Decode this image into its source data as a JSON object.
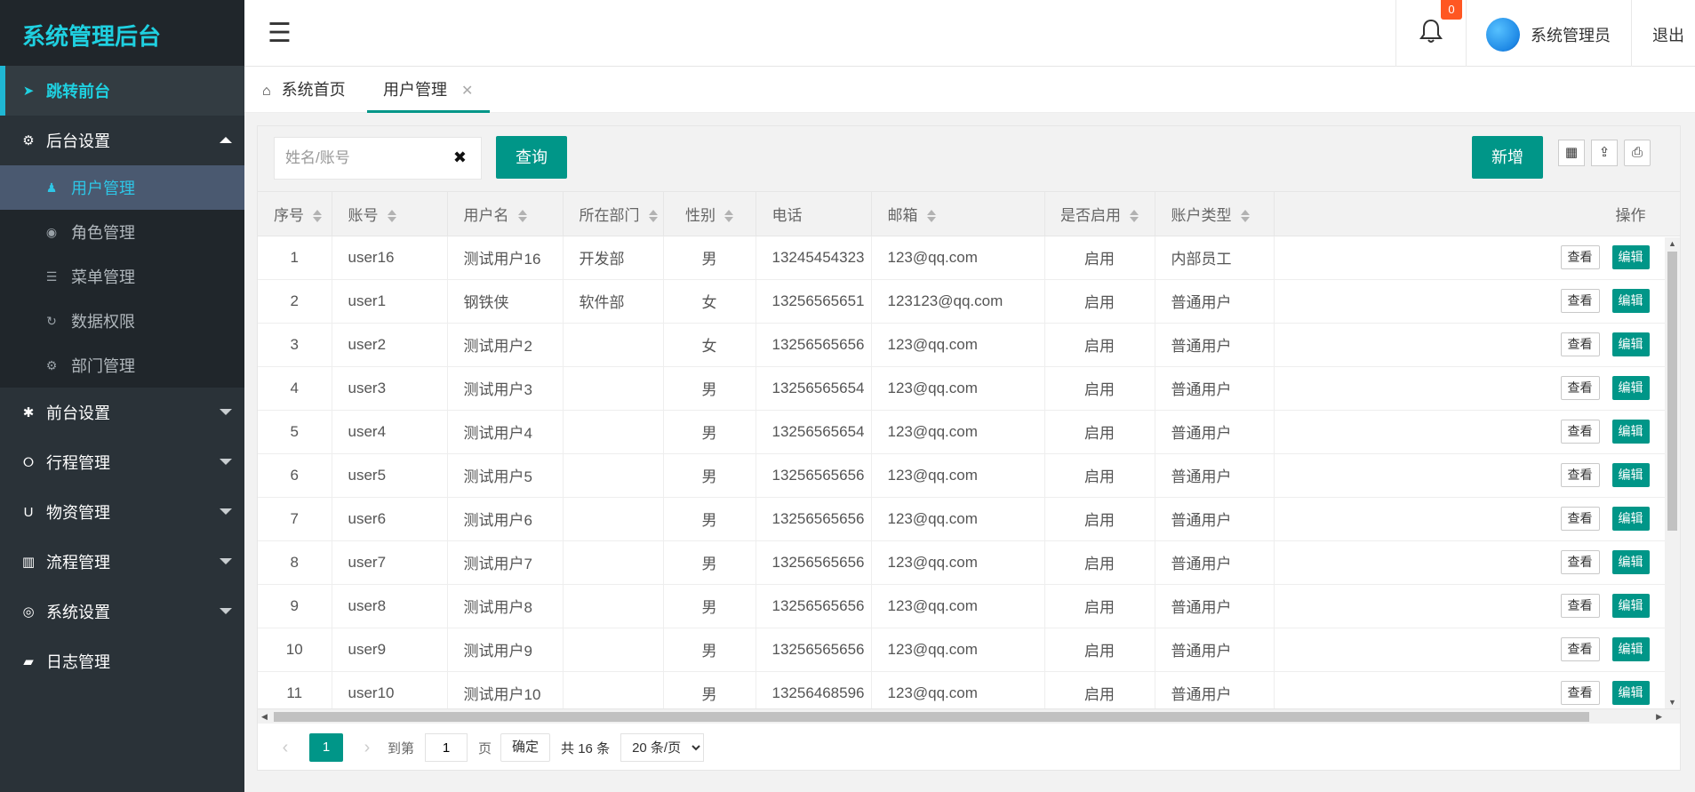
{
  "app": {
    "title": "系统管理后台"
  },
  "sidebar": {
    "front_link": "跳转前台",
    "groups": [
      {
        "label": "后台设置",
        "icon": "gear-icon",
        "open": true
      },
      {
        "label": "前台设置",
        "icon": "gear-icon"
      },
      {
        "label": "行程管理",
        "icon": "circle-icon"
      },
      {
        "label": "物资管理",
        "icon": "magnet-icon"
      },
      {
        "label": "流程管理",
        "icon": "barcode-icon"
      },
      {
        "label": "系统设置",
        "icon": "target-icon"
      },
      {
        "label": "日志管理",
        "icon": "book-icon"
      }
    ],
    "sub_items": [
      {
        "label": "用户管理",
        "icon": "user-icon",
        "active": true
      },
      {
        "label": "角色管理",
        "icon": "radio-icon"
      },
      {
        "label": "菜单管理",
        "icon": "list-icon"
      },
      {
        "label": "数据权限",
        "icon": "refresh-icon"
      },
      {
        "label": "部门管理",
        "icon": "gears-icon"
      }
    ]
  },
  "header": {
    "notification_count": "0",
    "user_name": "系统管理员",
    "logout_label": "退出"
  },
  "tabs": [
    {
      "label": "系统首页",
      "icon": "home-icon"
    },
    {
      "label": "用户管理",
      "active": true
    }
  ],
  "toolbar": {
    "search_placeholder": "姓名/账号",
    "search_value": "",
    "query_label": "查询",
    "add_label": "新增"
  },
  "table": {
    "columns": [
      "序号",
      "账号",
      "用户名",
      "所在部门",
      "性别",
      "电话",
      "邮箱",
      "是否启用",
      "账户类型",
      "操作"
    ],
    "view_label": "查看",
    "edit_label": "编辑",
    "rows": [
      [
        "1",
        "user16",
        "测试用户16",
        "开发部",
        "男",
        "13245454323",
        "123@qq.com",
        "启用",
        "内部员工"
      ],
      [
        "2",
        "user1",
        "钢铁侠",
        "软件部",
        "女",
        "13256565651",
        "123123@qq.com",
        "启用",
        "普通用户"
      ],
      [
        "3",
        "user2",
        "测试用户2",
        "",
        "女",
        "13256565656",
        "123@qq.com",
        "启用",
        "普通用户"
      ],
      [
        "4",
        "user3",
        "测试用户3",
        "",
        "男",
        "13256565654",
        "123@qq.com",
        "启用",
        "普通用户"
      ],
      [
        "5",
        "user4",
        "测试用户4",
        "",
        "男",
        "13256565654",
        "123@qq.com",
        "启用",
        "普通用户"
      ],
      [
        "6",
        "user5",
        "测试用户5",
        "",
        "男",
        "13256565656",
        "123@qq.com",
        "启用",
        "普通用户"
      ],
      [
        "7",
        "user6",
        "测试用户6",
        "",
        "男",
        "13256565656",
        "123@qq.com",
        "启用",
        "普通用户"
      ],
      [
        "8",
        "user7",
        "测试用户7",
        "",
        "男",
        "13256565656",
        "123@qq.com",
        "启用",
        "普通用户"
      ],
      [
        "9",
        "user8",
        "测试用户8",
        "",
        "男",
        "13256565656",
        "123@qq.com",
        "启用",
        "普通用户"
      ],
      [
        "10",
        "user9",
        "测试用户9",
        "",
        "男",
        "13256565656",
        "123@qq.com",
        "启用",
        "普通用户"
      ],
      [
        "11",
        "user10",
        "测试用户10",
        "",
        "男",
        "13256468596",
        "123@qq.com",
        "启用",
        "普通用户"
      ]
    ]
  },
  "pager": {
    "current_page": "1",
    "goto_label": "到第",
    "goto_value": "1",
    "page_unit": "页",
    "confirm_label": "确定",
    "total_text": "共 16 条",
    "page_size": "20 条/页"
  },
  "colors": {
    "accent": "#009688",
    "sidebar_bg": "#2a3238",
    "logo_text": "#1fd0e0",
    "active_sub_bg": "#4a5970",
    "badge": "#ff5722"
  }
}
